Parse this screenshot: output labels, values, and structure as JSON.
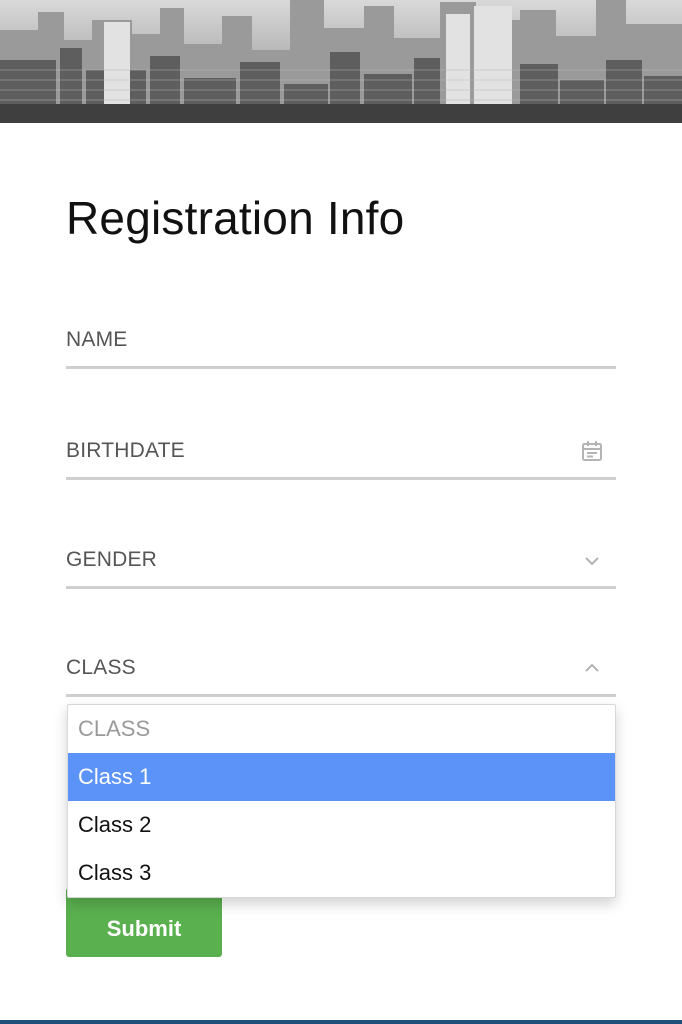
{
  "form": {
    "title": "Registration Info",
    "fields": {
      "name": {
        "label": "NAME"
      },
      "birthdate": {
        "label": "BIRTHDATE",
        "icon": "calendar-icon"
      },
      "gender": {
        "label": "GENDER",
        "icon": "chevron-down-icon"
      },
      "class": {
        "label": "CLASS",
        "icon": "chevron-up-icon",
        "expanded": true
      }
    },
    "class_dropdown": {
      "options": [
        "CLASS",
        "Class 1",
        "Class 2",
        "Class 3"
      ],
      "highlighted": "Class 1"
    },
    "submit_label": "Submit"
  },
  "colors": {
    "highlight": "#5b93f8",
    "submit": "#5ab04f",
    "underline": "#cfcfcf"
  }
}
